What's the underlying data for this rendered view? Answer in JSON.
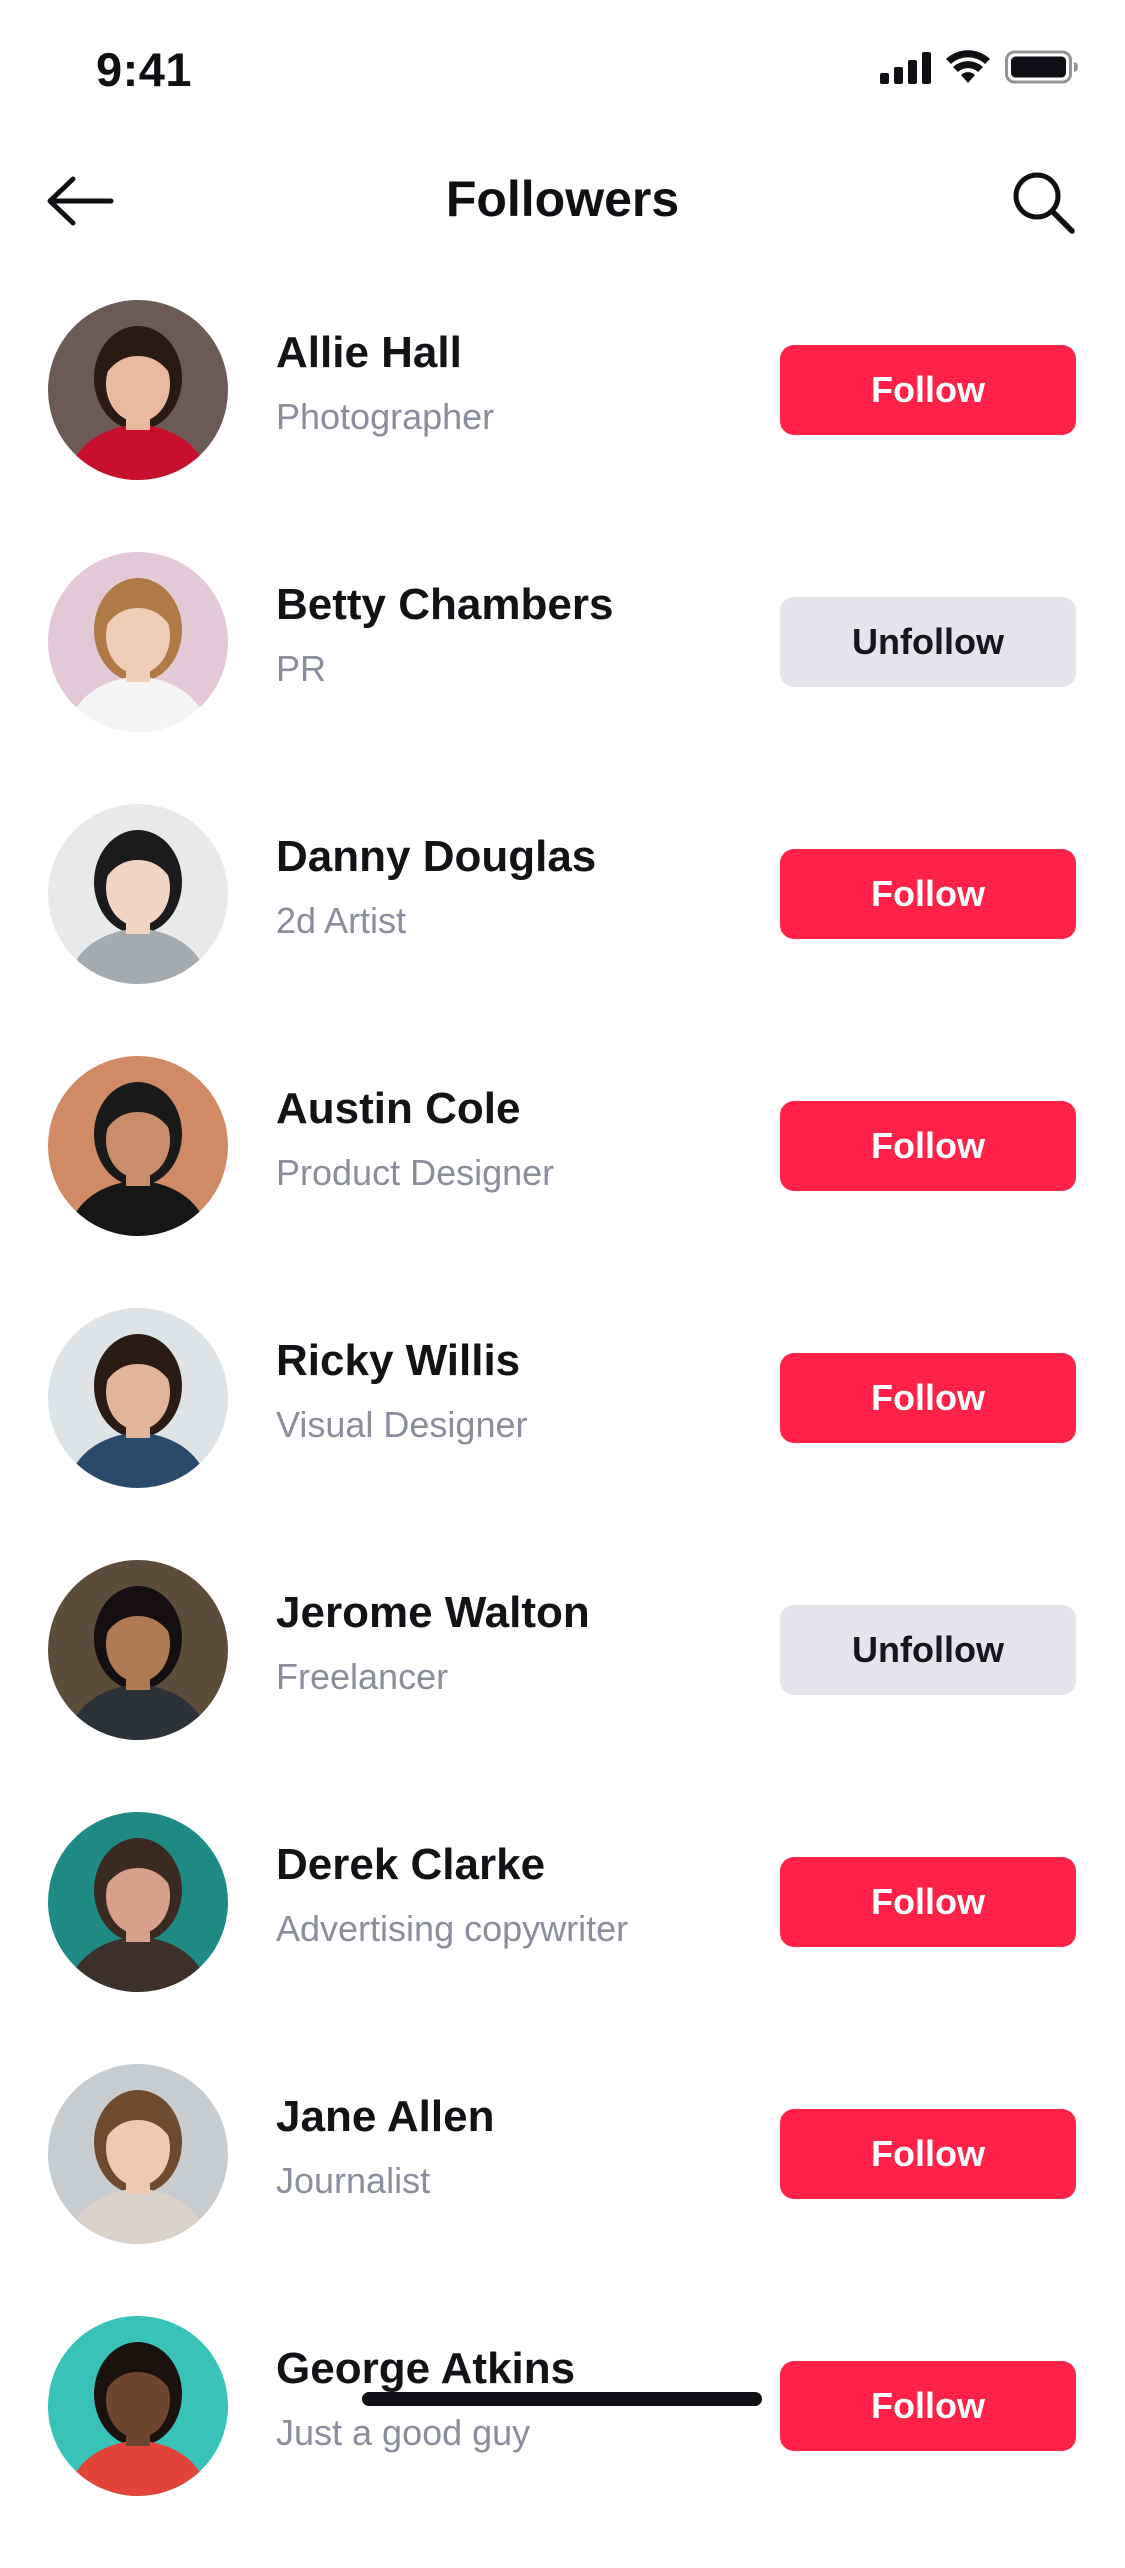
{
  "status_bar": {
    "time": "9:41"
  },
  "nav": {
    "title": "Followers",
    "back_icon": "arrow-left-icon",
    "search_icon": "search-icon"
  },
  "colors": {
    "follow_bg": "#ff2148",
    "unfollow_bg": "#e4e5e9",
    "role_text": "#8a8d9c"
  },
  "followers": [
    {
      "name": "Allie Hall",
      "role": "Photographer",
      "button": "Follow",
      "state": "follow",
      "avatar_bg": "#6b5a55",
      "avatar_skin": "#e9b9a0",
      "avatar_shirt": "#c8102e",
      "avatar_hair": "#2a1a14"
    },
    {
      "name": "Betty Chambers",
      "role": "PR",
      "button": "Unfollow",
      "state": "unfollow",
      "avatar_bg": "#e3c9d6",
      "avatar_skin": "#f0cdb7",
      "avatar_shirt": "#f4f4f4",
      "avatar_hair": "#b07a47"
    },
    {
      "name": "Danny Douglas",
      "role": "2d Artist",
      "button": "Follow",
      "state": "follow",
      "avatar_bg": "#e7e9ea",
      "avatar_skin": "#f1d4c3",
      "avatar_shirt": "#a7aaad",
      "avatar_hair": "#1b1b1d"
    },
    {
      "name": "Austin Cole",
      "role": "Product Designer",
      "button": "Follow",
      "state": "follow",
      "avatar_bg": "#d08a66",
      "avatar_skin": "#c98d6c",
      "avatar_shirt": "#161616",
      "avatar_hair": "#1a1a1a"
    },
    {
      "name": "Ricky Willis",
      "role": "Visual Designer",
      "button": "Follow",
      "state": "follow",
      "avatar_bg": "#dfe3e6",
      "avatar_skin": "#e2b49a",
      "avatar_shirt": "#2b4a6b",
      "avatar_hair": "#2a1c14"
    },
    {
      "name": "Jerome Walton",
      "role": "Freelancer",
      "button": "Unfollow",
      "state": "unfollow",
      "avatar_bg": "#5c4c3a",
      "avatar_skin": "#b07a55",
      "avatar_shirt": "#2d3238",
      "avatar_hair": "#141011"
    },
    {
      "name": "Derek Clarke",
      "role": "Advertising copywriter",
      "button": "Follow",
      "state": "follow",
      "avatar_bg": "#1f8a84",
      "avatar_skin": "#d7a08a",
      "avatar_shirt": "#3d2f2a",
      "avatar_hair": "#3a2a22"
    },
    {
      "name": "Jane Allen",
      "role": "Journalist",
      "button": "Follow",
      "state": "follow",
      "avatar_bg": "#c9ccce",
      "avatar_skin": "#efc9b1",
      "avatar_shirt": "#d8d2cb",
      "avatar_hair": "#6e4a2e"
    },
    {
      "name": "George Atkins",
      "role": "Just a good guy",
      "button": "Follow",
      "state": "follow",
      "avatar_bg": "#38c2b8",
      "avatar_skin": "#6e4630",
      "avatar_shirt": "#e2443a",
      "avatar_hair": "#1b1210"
    }
  ]
}
